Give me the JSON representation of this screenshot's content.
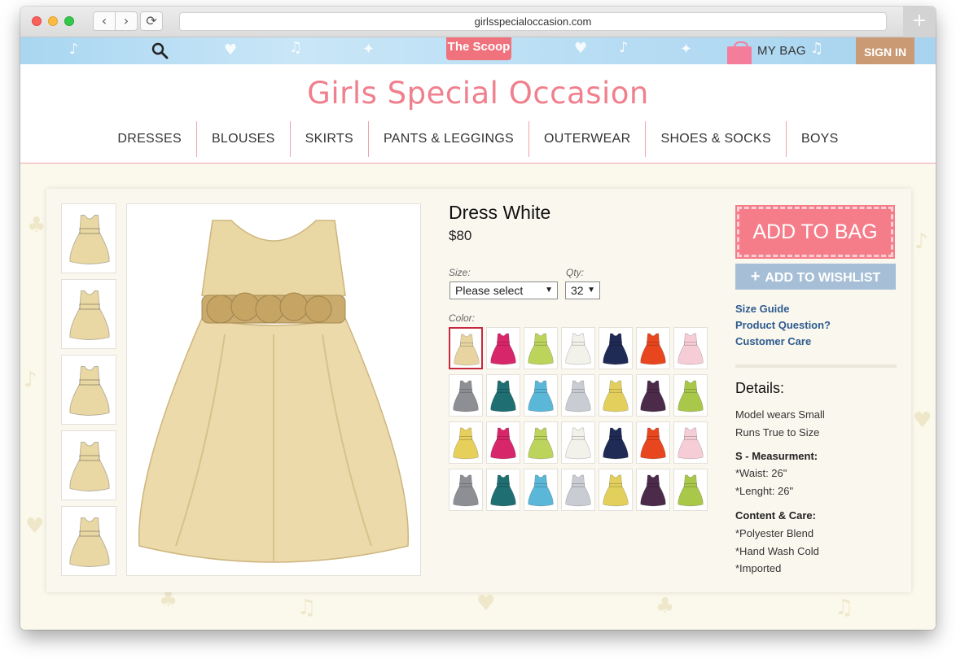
{
  "browser": {
    "url": "girlsspecialoccasion.com"
  },
  "topbar": {
    "scoop_label": "The Scoop",
    "mybag_label": "MY BAG",
    "signin_label": "SIGN IN"
  },
  "header": {
    "title": "Girls Special Occasion"
  },
  "nav": [
    {
      "label": "DRESSES"
    },
    {
      "label": "BLOUSES"
    },
    {
      "label": "SKIRTS"
    },
    {
      "label": "PANTS & LEGGINGS"
    },
    {
      "label": "OUTERWEAR"
    },
    {
      "label": "SHOES & SOCKS"
    },
    {
      "label": "BOYS"
    }
  ],
  "product": {
    "name": "Dress White",
    "price": "$80",
    "size_label": "Size:",
    "size_value": "Please select",
    "qty_label": "Qty:",
    "qty_value": "32",
    "color_label": "Color:",
    "thumb_count": 5,
    "main_color": "#e9d7a4",
    "swatches": [
      "#e7d4a0",
      "#d8266a",
      "#bcd35c",
      "#f2f1ea",
      "#1f2a55",
      "#e8461f",
      "#f6cdd6",
      "#8d8f95",
      "#1e6e72",
      "#5ab7d8",
      "#c9ccd2",
      "#e3cf5c",
      "#4b2a4a",
      "#a9c84a",
      "#e6cf5a",
      "#d8266a",
      "#bcd35c",
      "#f2f1ea",
      "#1f2a55",
      "#e8461f",
      "#f6cdd6",
      "#8d8f95",
      "#1e6e72",
      "#5ab7d8",
      "#c9ccd2",
      "#e3cf5c",
      "#4b2a4a",
      "#a9c84a"
    ]
  },
  "actions": {
    "add_to_bag": "ADD TO BAG",
    "add_to_wishlist": "ADD TO WISHLIST",
    "wishlist_icon": "+"
  },
  "links": {
    "size_guide": "Size Guide",
    "product_question": "Product Question?",
    "customer_care": "Customer Care"
  },
  "details": {
    "title": "Details:",
    "line1": "Model wears Small",
    "line2": "Runs True to Size",
    "measure_head": "S - Measurment:",
    "waist": "*Waist: 26\"",
    "length": "*Lenght: 26\"",
    "care_head": "Content & Care:",
    "care1": "*Polyester Blend",
    "care2": "*Hand Wash Cold",
    "care3": "*Imported"
  }
}
